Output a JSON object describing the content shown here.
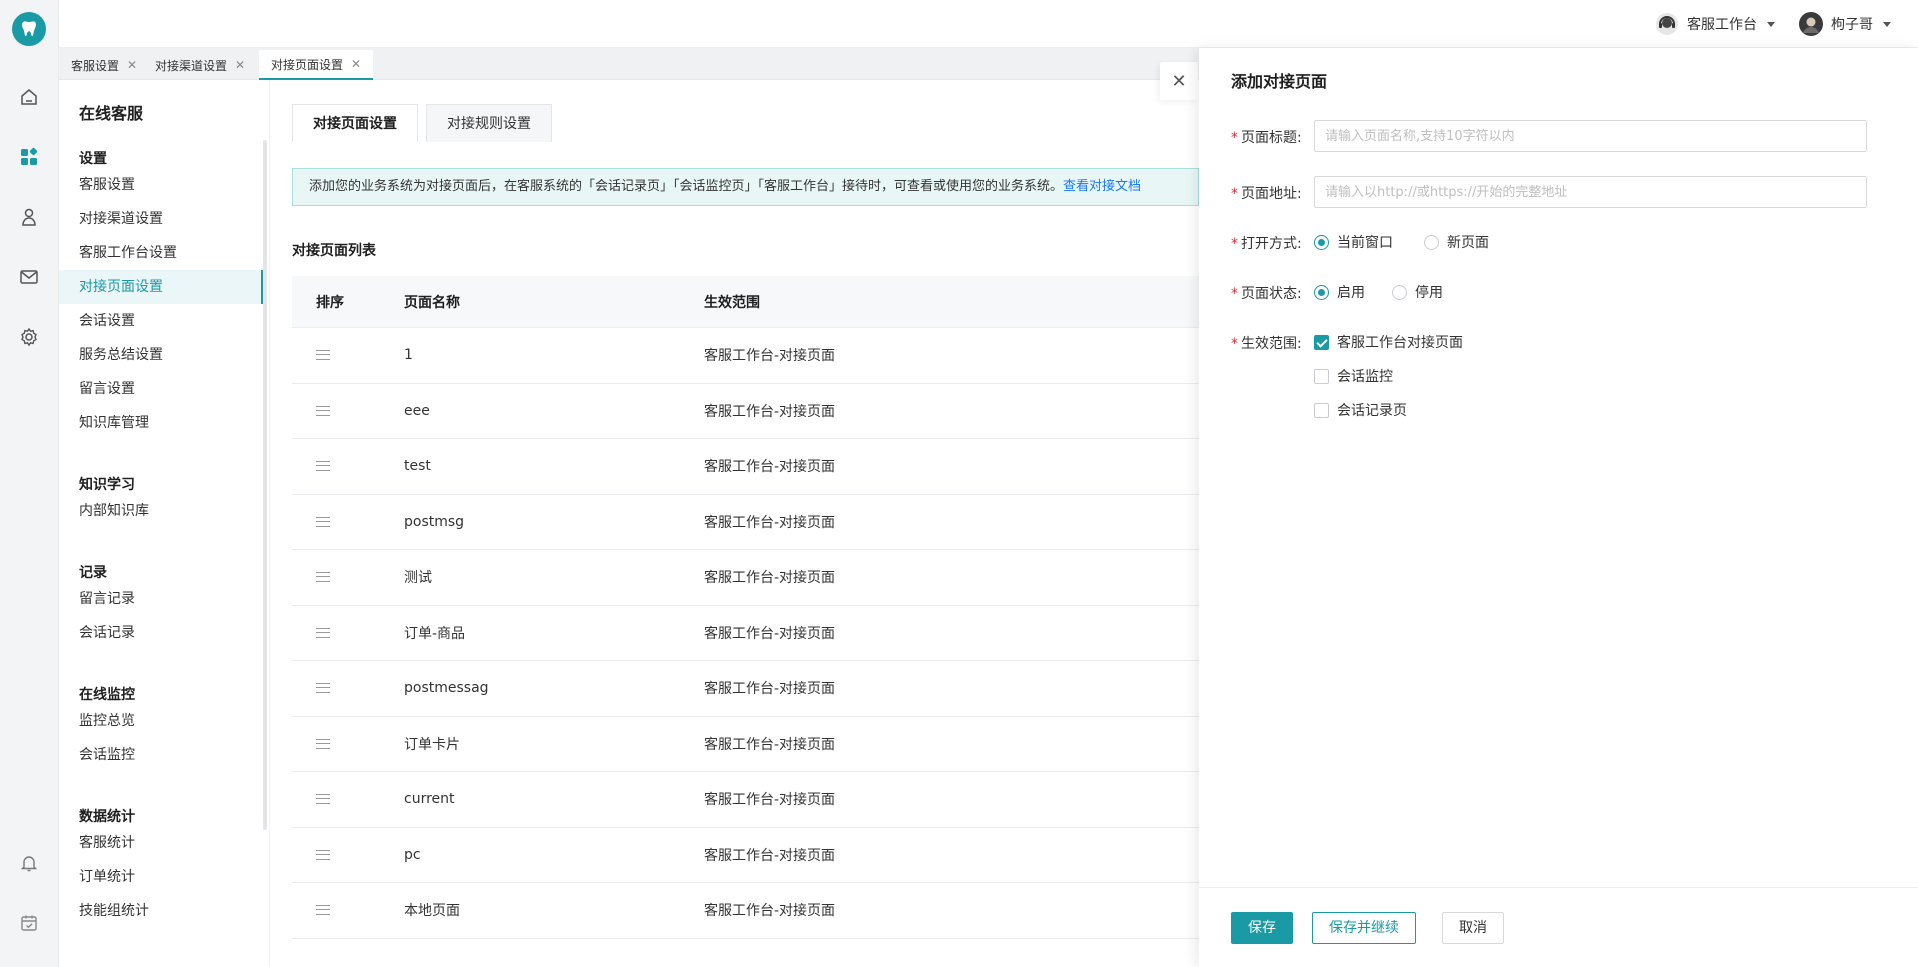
{
  "rail": {
    "icons": [
      "tooth-logo-icon",
      "home-icon",
      "apps-icon",
      "customer-icon",
      "mail-icon",
      "settings-icon",
      "bell-icon",
      "calendar-icon"
    ]
  },
  "topbar": {
    "workspace_label": "客服工作台",
    "user_name": "枸子哥"
  },
  "page_tabs": [
    {
      "label": "客服设置",
      "active": false
    },
    {
      "label": "对接渠道设置",
      "active": false
    },
    {
      "label": "对接页面设置",
      "active": true
    }
  ],
  "sidenav": {
    "title": "在线客服",
    "groups": [
      {
        "label": "设置",
        "items": [
          "客服设置",
          "对接渠道设置",
          "客服工作台设置",
          "对接页面设置",
          "会话设置",
          "服务总结设置",
          "留言设置",
          "知识库管理"
        ]
      },
      {
        "label": "知识学习",
        "items": [
          "内部知识库"
        ]
      },
      {
        "label": "记录",
        "items": [
          "留言记录",
          "会话记录"
        ]
      },
      {
        "label": "在线监控",
        "items": [
          "监控总览",
          "会话监控"
        ]
      },
      {
        "label": "数据统计",
        "items": [
          "客服统计",
          "订单统计",
          "技能组统计"
        ]
      }
    ],
    "active_item": "对接页面设置"
  },
  "content": {
    "tabs": [
      {
        "label": "对接页面设置",
        "active": true
      },
      {
        "label": "对接规则设置",
        "active": false
      }
    ],
    "notice_text": "添加您的业务系统为对接页面后，在客服系统的「会话记录页」「会话监控页」「客服工作台」接待时，可查看或使用您的业务系统。",
    "notice_link": "查看对接文档",
    "list_title": "对接页面列表",
    "table": {
      "headers": [
        "排序",
        "页面名称",
        "生效范围"
      ],
      "rows": [
        {
          "name": "1",
          "scope": "客服工作台-对接页面"
        },
        {
          "name": "eee",
          "scope": "客服工作台-对接页面"
        },
        {
          "name": "test",
          "scope": "客服工作台-对接页面"
        },
        {
          "name": "postmsg",
          "scope": "客服工作台-对接页面"
        },
        {
          "name": "测试",
          "scope": "客服工作台-对接页面"
        },
        {
          "name": "订单-商品",
          "scope": "客服工作台-对接页面"
        },
        {
          "name": "postmessag",
          "scope": "客服工作台-对接页面"
        },
        {
          "name": "订单卡片",
          "scope": "客服工作台-对接页面"
        },
        {
          "name": "current",
          "scope": "客服工作台-对接页面"
        },
        {
          "name": "pc",
          "scope": "客服工作台-对接页面"
        },
        {
          "name": "本地页面",
          "scope": "客服工作台-对接页面"
        }
      ]
    }
  },
  "drawer": {
    "close_icon": "close-icon",
    "title": "添加对接页面",
    "fields": {
      "page_title": {
        "label": "页面标题:",
        "placeholder": "请输入页面名称,支持10字符以内",
        "value": ""
      },
      "page_url": {
        "label": "页面地址:",
        "placeholder": "请输入以http://或https://开始的完整地址",
        "value": ""
      },
      "open_mode": {
        "label": "打开方式:",
        "options": [
          "当前窗口",
          "新页面"
        ],
        "selected": "当前窗口"
      },
      "status": {
        "label": "页面状态:",
        "options": [
          "启用",
          "停用"
        ],
        "selected": "启用"
      },
      "scope": {
        "label": "生效范围:",
        "options": [
          {
            "label": "客服工作台对接页面",
            "checked": true
          },
          {
            "label": "会话监控",
            "checked": false
          },
          {
            "label": "会话记录页",
            "checked": false
          }
        ]
      }
    },
    "buttons": {
      "save": "保存",
      "save_continue": "保存并继续",
      "cancel": "取消"
    }
  },
  "colors": {
    "accent": "#1a9aa5",
    "link": "#1677ff",
    "required": "#f5222d"
  }
}
